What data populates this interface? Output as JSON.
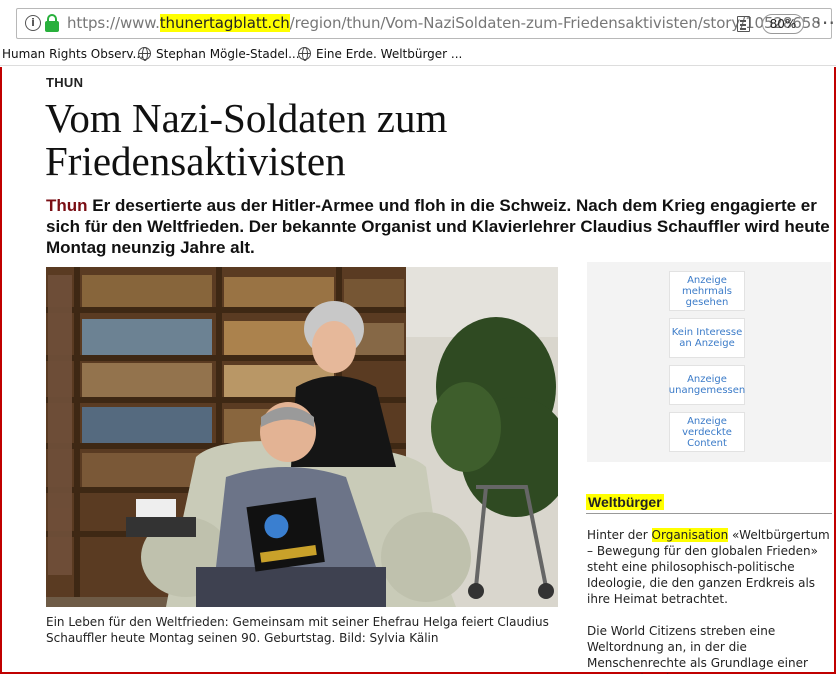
{
  "browser": {
    "url_prefix": "https://www.",
    "url_domain": "thunertagblatt.ch",
    "url_path": "/region/thun/Vom-NaziSoldaten-zum-Friedensaktivisten/story/10528658",
    "zoom": "80%"
  },
  "bookmarks": [
    "Human Rights Observ...",
    "Stephan Mögle-Stadel...",
    "Eine Erde. Weltbürger ..."
  ],
  "article": {
    "kicker": "THUN",
    "headline": "Vom Nazi-Soldaten zum Friedensaktivisten",
    "lead_city": "Thun",
    "lead_text": "Er desertierte aus der Hitler-Armee und floh in die Schweiz. Nach dem Krieg engagierte er sich für den Weltfrieden. Der bekannte Organist und Klavierlehrer Claudius Schauffler wird heute Montag neunzig Jahre alt.",
    "caption": "Ein Leben für den Weltfrieden: Gemeinsam mit seiner Ehefrau Helga feiert Claudius Schauffler heute Montag seinen 90. Geburtstag. Bild: Sylvia Kälin"
  },
  "ad_feedback": [
    "Anzeige mehrmals gesehen",
    "Kein Interesse an Anzeige",
    "Anzeige unangemessen",
    "Anzeige verdeckte Content"
  ],
  "sidebar": {
    "title": "Weltbürger",
    "p1_before": "Hinter der ",
    "p1_highlight": "Organisation",
    "p1_after": " «Weltbürgertum – Bewegung für den globalen Frieden» steht eine philosophisch-politische Ideologie, die den ganzen Erdkreis als ihre Heimat betrachtet.",
    "p2": "Die World Citizens streben eine Weltordnung an, in der die Menschenrechte als Grundlage einer supranationalen"
  },
  "colors": {
    "frame": "#c00000",
    "highlight": "#ffff00",
    "city": "#7a0e14",
    "ad_link": "#3b7bc8",
    "lock": "#28b03c"
  }
}
